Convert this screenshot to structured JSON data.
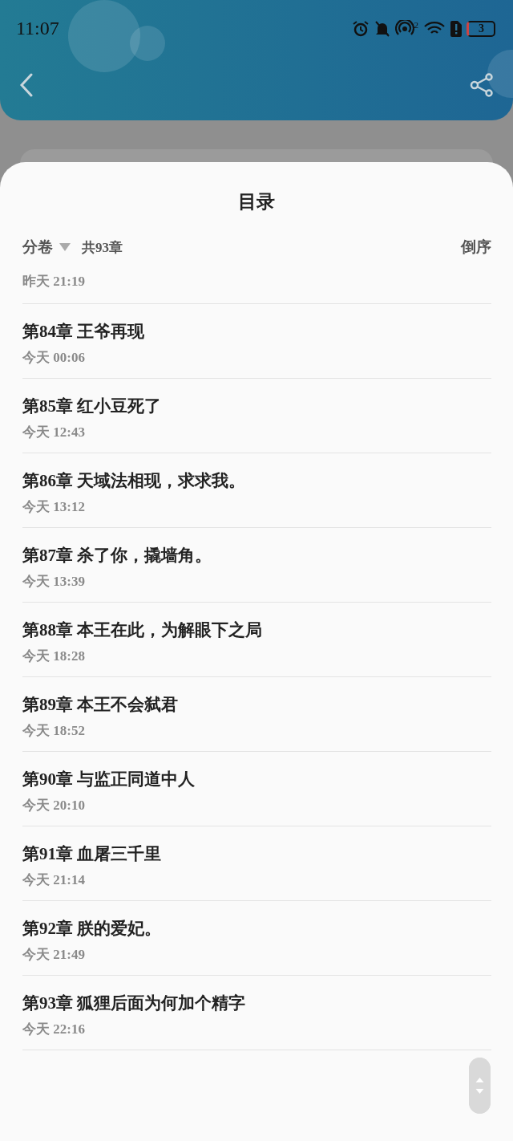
{
  "status_bar": {
    "time": "11:07",
    "hotspot_count": "2",
    "battery": "3"
  },
  "sheet": {
    "title": "目录",
    "volume_label": "分卷",
    "chapter_count": "共93章",
    "sort_label": "倒序"
  },
  "chapters": [
    {
      "time": "昨天 21:19"
    },
    {
      "title": "第84章 王爷再现",
      "time": "今天 00:06"
    },
    {
      "title": "第85章 红小豆死了",
      "time": "今天 12:43"
    },
    {
      "title": "第86章 天域法相现，求求我。",
      "time": "今天 13:12"
    },
    {
      "title": "第87章 杀了你，撬墙角。",
      "time": "今天 13:39"
    },
    {
      "title": "第88章 本王在此，为解眼下之局",
      "time": "今天 18:28"
    },
    {
      "title": "第89章 本王不会弑君",
      "time": "今天 18:52"
    },
    {
      "title": "第90章 与监正同道中人",
      "time": "今天 20:10"
    },
    {
      "title": "第91章 血屠三千里",
      "time": "今天 21:14"
    },
    {
      "title": "第92章 朕的爱妃。",
      "time": "今天 21:49"
    },
    {
      "title": "第93章 狐狸后面为何加个精字",
      "time": "今天 22:16"
    }
  ]
}
